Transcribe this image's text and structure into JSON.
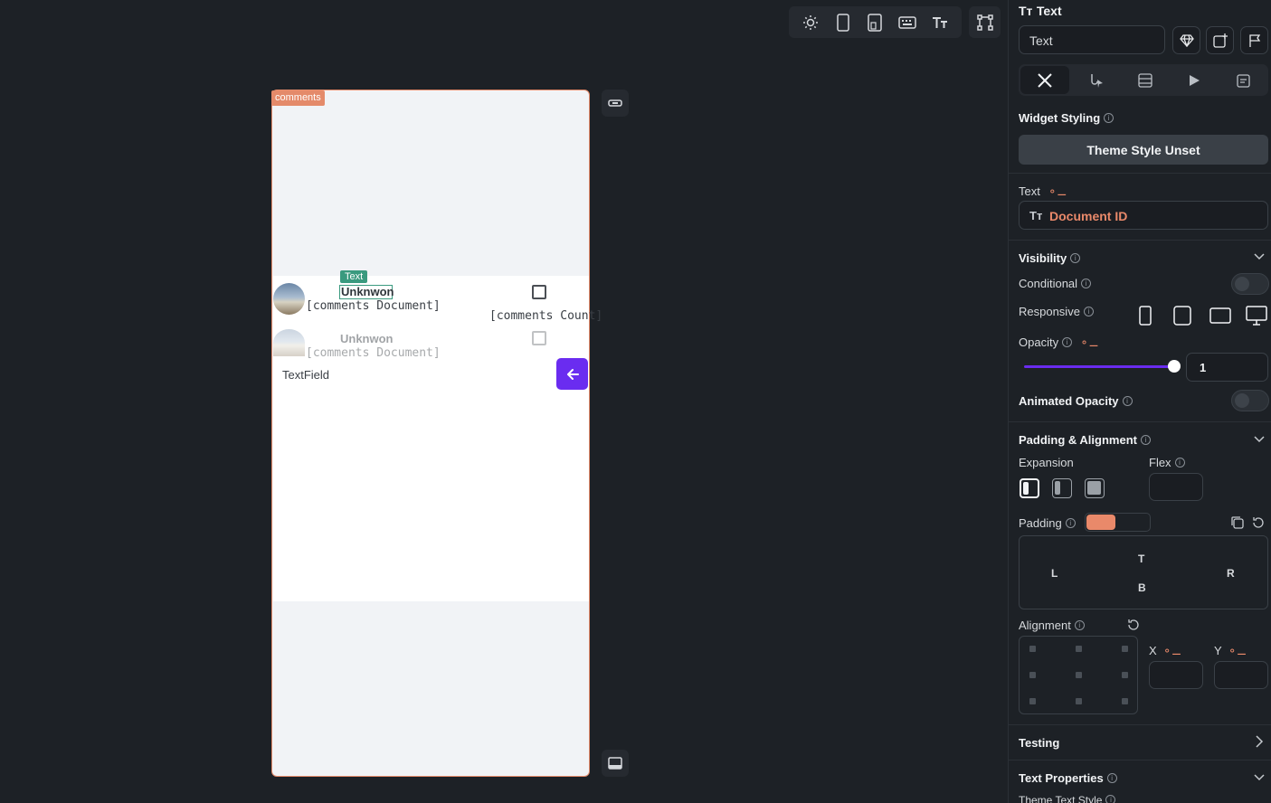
{
  "toolbar": {
    "icons": [
      "sun-icon",
      "phone-icon",
      "tablet-icon",
      "keyboard-icon",
      "text-size-icon",
      "widget-tree-icon"
    ]
  },
  "canvas": {
    "tag_label": "comments",
    "selected_tag": "Text",
    "rows": [
      {
        "title": "Unknwon",
        "subtitle": "[comments Document]",
        "count": "[comments Count]"
      },
      {
        "title": "Unknwon",
        "subtitle": "[comments Document]"
      }
    ],
    "textfield_label": "TextField"
  },
  "panel": {
    "header_title": "Text",
    "name_value": "Text",
    "widget_styling_label": "Widget Styling",
    "theme_style_button": "Theme Style Unset",
    "text_label": "Text",
    "text_value": "Document ID",
    "visibility_label": "Visibility",
    "conditional_label": "Conditional",
    "responsive_label": "Responsive",
    "opacity_label": "Opacity",
    "opacity_value": "1",
    "animated_opacity_label": "Animated Opacity",
    "padding_alignment_label": "Padding & Alignment",
    "expansion_label": "Expansion",
    "flex_label": "Flex",
    "padding_label": "Padding",
    "pad_t": "T",
    "pad_l": "L",
    "pad_r": "R",
    "pad_b": "B",
    "alignment_label": "Alignment",
    "x_label": "X",
    "y_label": "Y",
    "testing_label": "Testing",
    "text_properties_label": "Text Properties",
    "theme_text_style_label": "Theme Text Style"
  },
  "colors": {
    "accent": "#6a2cf0",
    "orange": "#e9896a",
    "selection": "#3a9a7f"
  }
}
